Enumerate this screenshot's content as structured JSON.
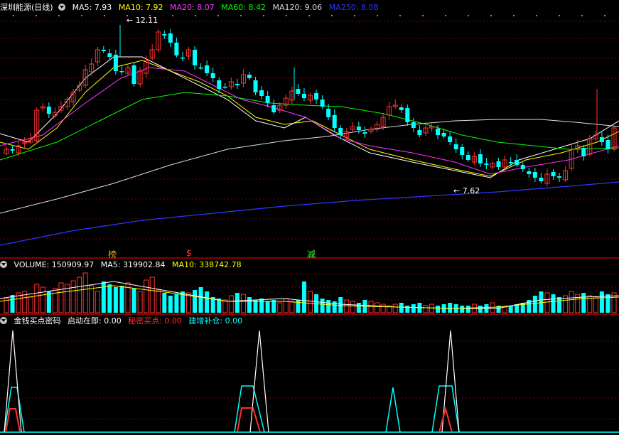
{
  "main_panel": {
    "title": "深圳能源(日线)",
    "ma": [
      {
        "label": "MA5: 7.93",
        "color": "#ffffff"
      },
      {
        "label": "MA10: 7.92",
        "color": "#ffff00"
      },
      {
        "label": "MA20: 8.07",
        "color": "#ff00ff"
      },
      {
        "label": "MA60: 8.42",
        "color": "#00ff00"
      },
      {
        "label": "MA120: 9.06",
        "color": "#cccccc"
      },
      {
        "label": "MA250: 8.08",
        "color": "#3333ff"
      }
    ],
    "high_label": "12.11",
    "low_label": "7.62",
    "markers": [
      {
        "text": "榜",
        "color": "#e0a020"
      },
      {
        "text": "$",
        "color": "#ff3030"
      },
      {
        "text": "减",
        "color": "#30ff30"
      }
    ]
  },
  "volume_panel": {
    "title": "VOLUME: 150909.97",
    "ma5": "MA5: 319902.84",
    "ma10": "MA10: 338742.78"
  },
  "indicator_panel": {
    "name": "金钱买点密码",
    "items": [
      {
        "label": "启动在即: 0.00",
        "color": "#ffffff"
      },
      {
        "label": "秘密买点: 0.00",
        "color": "#ff3030"
      },
      {
        "label": "建增补仓: 0.00",
        "color": "#00ffff"
      }
    ]
  },
  "colors": {
    "up": "#ff3232",
    "down": "#00ffff",
    "grid": "#8b0000"
  }
}
